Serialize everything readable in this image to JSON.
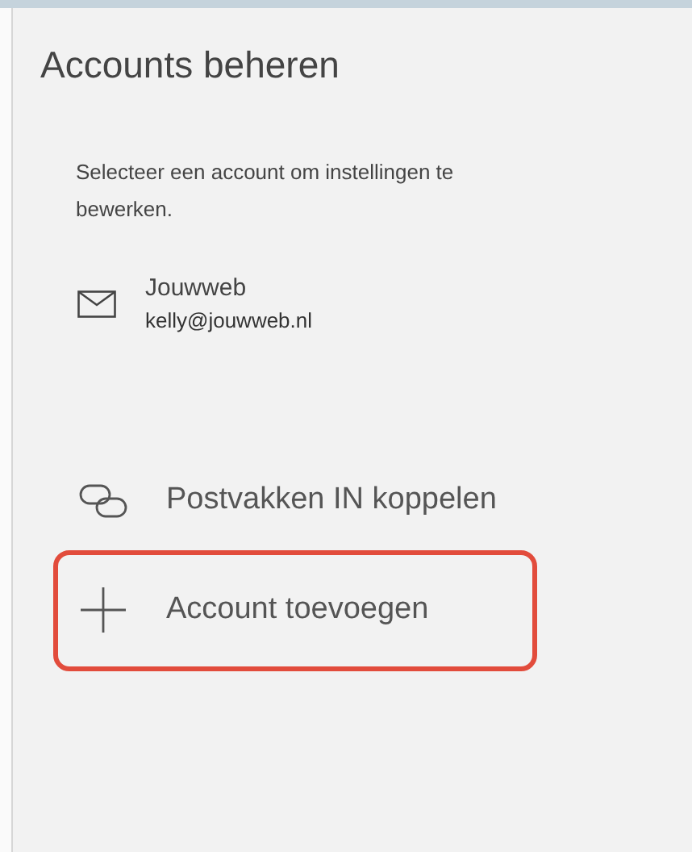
{
  "title": "Accounts beheren",
  "description": "Selecteer een account om instellingen te bewerken.",
  "accounts": [
    {
      "name": "Jouwweb",
      "email": "kelly@jouwweb.nl"
    }
  ],
  "actions": [
    {
      "kind": "link",
      "label": "Postvakken IN koppelen",
      "highlighted": false
    },
    {
      "kind": "add",
      "label": "Account toevoegen",
      "highlighted": true
    }
  ]
}
